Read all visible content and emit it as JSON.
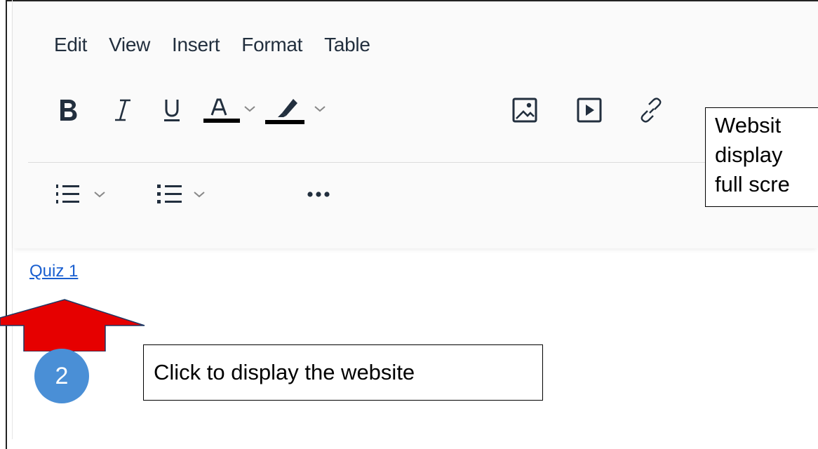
{
  "menubar": {
    "items": [
      "Edit",
      "View",
      "Insert",
      "Format",
      "Table"
    ]
  },
  "content": {
    "link_text": "Quiz 1"
  },
  "callouts": {
    "right": [
      "Websit",
      "display",
      "full scre"
    ],
    "bottom": "Click to display the website"
  },
  "step": {
    "number": "2"
  },
  "colors": {
    "text_color": "#000000",
    "highlight_color": "#000000",
    "link": "#1a5fd0",
    "arrow": "#e60000",
    "step_circle": "#4a8fd6"
  }
}
